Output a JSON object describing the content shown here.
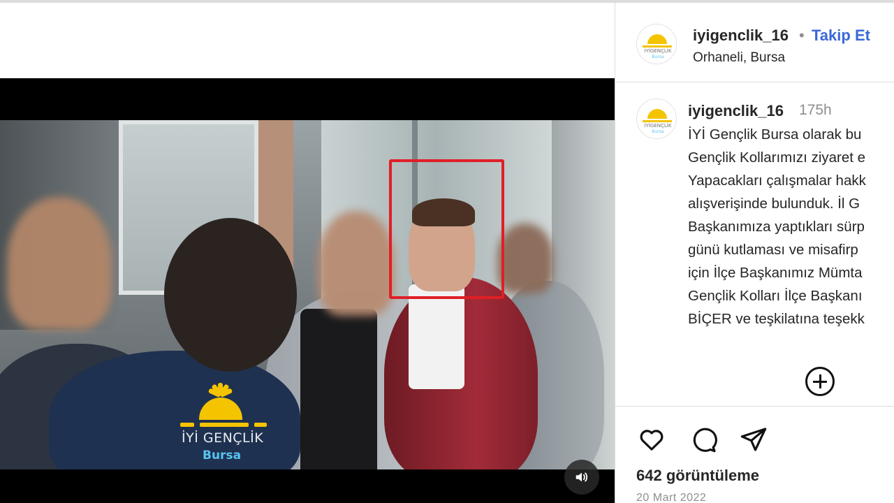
{
  "post": {
    "username": "iyigenclik_16",
    "separator": "•",
    "follow_label": "Takip Et",
    "location": "Orhaneli, Bursa"
  },
  "avatar": {
    "brand_text": "İYİGENÇLİK",
    "brand_sub": "Bursa"
  },
  "caption": {
    "username": "iyigenclik_16",
    "time": "175h",
    "lines": [
      "İYİ Gençlik Bursa olarak bu",
      "Gençlik Kollarımızı ziyaret e",
      "Yapacakları çalışmalar hakk",
      "alışverişinde bulunduk. İl G",
      "Başkanımıza yaptıkları sürp",
      "günü kutlaması ve misafirp",
      "için İlçe Başkanımız Mümta",
      "Gençlik Kolları İlçe Başkanı",
      "BİÇER ve teşkilatına teşekk"
    ]
  },
  "video": {
    "watermark_title": "İYİ GENÇLİK",
    "watermark_sub": "Bursa"
  },
  "stats": {
    "views": "642 görüntüleme",
    "date": "20 Mart 2022"
  },
  "icons": {
    "volume": "volume-icon",
    "more": "plus-circle-icon",
    "like": "heart-icon",
    "comment": "comment-icon",
    "share": "send-icon"
  },
  "colors": {
    "follow": "#3a68d8",
    "secondary_text": "#8e8e8e",
    "highlight_box": "#e01f26",
    "brand_yellow": "#f5c400",
    "brand_blue": "#58c4f0"
  }
}
